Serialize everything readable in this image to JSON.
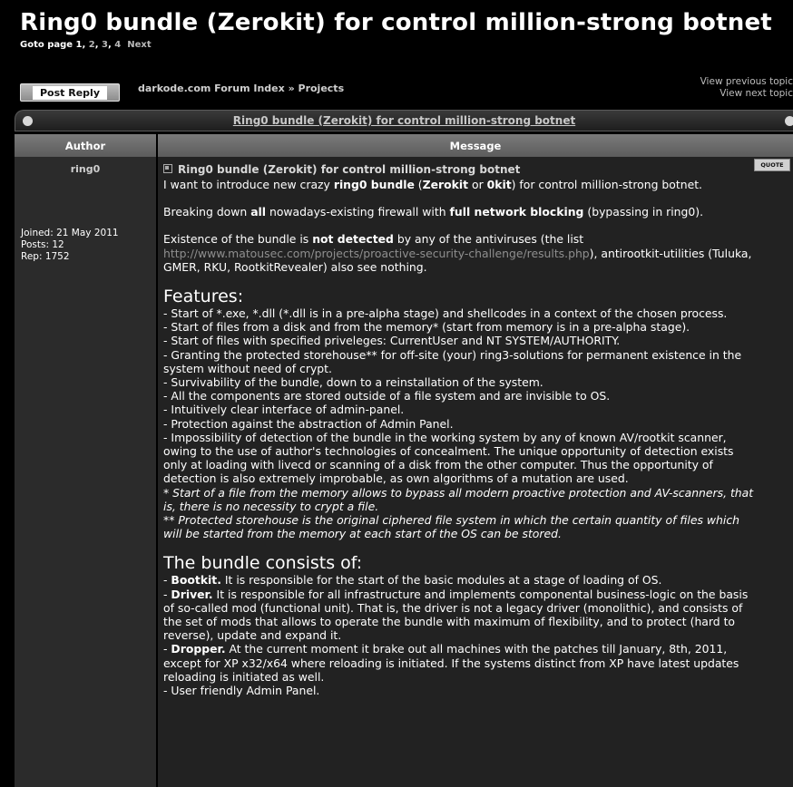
{
  "page": {
    "title": "Ring0 bundle (Zerokit) for control million-strong botnet",
    "pagination": {
      "prefix": "Goto page",
      "current": "1",
      "pages": [
        "2",
        "3",
        "4"
      ],
      "next": "Next"
    }
  },
  "toolbar": {
    "post_reply_label": "Post Reply"
  },
  "breadcrumb": {
    "index": "darkode.com Forum Index",
    "sep": "»",
    "forum": "Projects"
  },
  "topic_nav": {
    "previous": "View previous topic",
    "next": "View next topic"
  },
  "table": {
    "title_link": "Ring0 bundle (Zerokit) for control million-strong botnet",
    "headers": {
      "author": "Author",
      "message": "Message"
    }
  },
  "post": {
    "author": {
      "name": "ring0",
      "joined": "Joined: 21 May 2011",
      "posts": "Posts: 12",
      "rep": "Rep: 1752"
    },
    "subject": "Ring0 bundle (Zerokit) for control million-strong botnet",
    "quote_label": "QUOTE",
    "intro": {
      "a": "I want to introduce new crazy ",
      "b1": "ring0 bundle",
      "c": " (",
      "b2": "Zerokit",
      "d": " or ",
      "b3": "0kit",
      "e": ") for control million-strong botnet."
    },
    "p2": {
      "a": "Breaking down ",
      "b1": "all",
      "c": " nowadays-existing firewall with ",
      "b2": "full network blocking",
      "d": " (bypassing in ring0)."
    },
    "p3": {
      "a": "Existence of the bundle is ",
      "b1": "not detected",
      "c": " by any of the antiviruses (the list",
      "link": "http://www.matousec.com/projects/proactive-security-challenge/results.php",
      "d": "), antirootkit-utilities (Tuluka,",
      "e": "GMER, RKU, RootkitRevealer) also see nothing."
    },
    "features_heading": "Features:",
    "features": [
      "- Start of *.exe, *.dll (*.dll is in a pre-alpha stage) and shellcodes in a context of the chosen process.",
      "- Start of files from a disk and from the memory* (start from memory is in a pre-alpha stage).",
      "- Start of files with specified priveleges: CurrentUser and NT SYSTEM/AUTHORITY.",
      "- Granting the protected storehouse** for off-site (your) ring3-solutions for permanent existence in the",
      "system without need of crypt.",
      "- Survivability of the bundle, down to a reinstallation of the system.",
      "- All the components are stored outside of a file system and are invisible to OS.",
      "- Intuitively clear interface of admin-panel.",
      "- Protection against the abstraction of Admin Panel.",
      "- Impossibility of detection of the bundle in the working system by any of known AV/rootkit scanner,",
      "owing to the use of author's technologies of concealment. The unique opportunity of detection exists",
      "only at loading with livecd or scanning of a disk from the other computer. Thus the opportunity of",
      "detection is also extremely improbable, as own algorithms of a mutation are used."
    ],
    "footnotes": [
      "* Start of a file from the memory allows to bypass all modern proactive protection and AV-scanners, that",
      "is, there is no necessity to crypt a file.",
      "** Protected storehouse is the original ciphered file system in which the certain quantity of files which",
      "will be started from the memory at each start of the OS can be stored."
    ],
    "consists_heading": "The bundle consists of:",
    "components": {
      "bootkit_label": "Bootkit.",
      "bootkit_text": " It is responsible for the start of the basic modules at a stage of loading of OS.",
      "driver_label": "Driver.",
      "driver_lines": [
        " It is responsible for all infrastructure and implements componental business-logic on the basis",
        "of so-called mod (functional unit). That is, the driver is not a legacy driver (monolithic), and consists of",
        "the set of mods that allows to operate the bundle with maximum of flexibility, and to protect (hard to",
        "reverse), update and expand it."
      ],
      "dropper_label": "Dropper.",
      "dropper_lines": [
        " At the current moment it brake out all machines with the patches till January, 8th, 2011,",
        "except for XP x32/x64 where reloading is initiated. If the systems distinct from XP have latest updates",
        "reloading is initiated as well."
      ],
      "admin_panel": "- User friendly Admin Panel."
    }
  }
}
